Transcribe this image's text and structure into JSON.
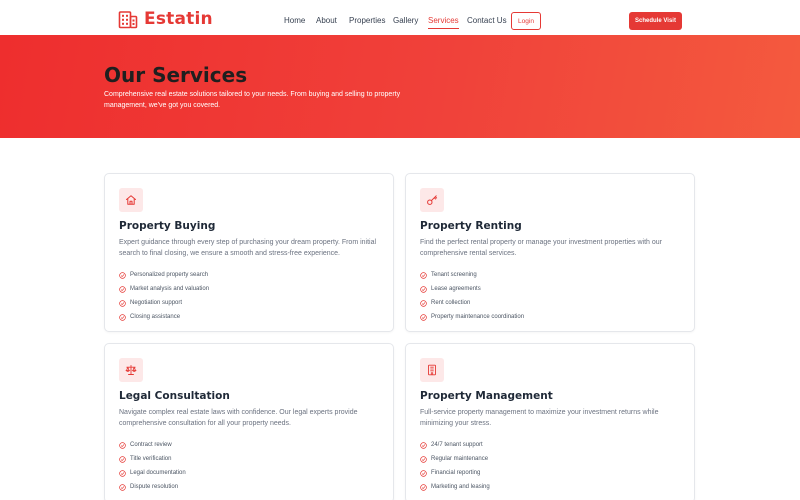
{
  "brand": {
    "name": "Estatin",
    "color": "#e53935"
  },
  "nav": {
    "items": [
      {
        "label": "Home",
        "active": false
      },
      {
        "label": "About",
        "active": false
      },
      {
        "label": "Properties",
        "active": false
      },
      {
        "label": "Gallery",
        "active": false
      },
      {
        "label": "Services",
        "active": true
      },
      {
        "label": "Contact Us",
        "active": false
      }
    ],
    "login_label": "Login",
    "cta_label": "Schedule Visit"
  },
  "hero": {
    "title": "Our Services",
    "subtitle": "Comprehensive real estate solutions tailored to your needs. From buying and selling to property management, we've got you covered."
  },
  "services": [
    {
      "icon": "home-icon",
      "title": "Property Buying",
      "description": "Expert guidance through every step of purchasing your dream property. From initial search to final closing, we ensure a smooth and stress-free experience.",
      "features": [
        "Personalized property search",
        "Market analysis and valuation",
        "Negotiation support",
        "Closing assistance"
      ]
    },
    {
      "icon": "key-icon",
      "title": "Property Renting",
      "description": "Find the perfect rental property or manage your investment properties with our comprehensive rental services.",
      "features": [
        "Tenant screening",
        "Lease agreements",
        "Rent collection",
        "Property maintenance coordination"
      ]
    },
    {
      "icon": "scale-icon",
      "title": "Legal Consultation",
      "description": "Navigate complex real estate laws with confidence. Our legal experts provide comprehensive consultation for all your property needs.",
      "features": [
        "Contract review",
        "Title verification",
        "Legal documentation",
        "Dispute resolution"
      ]
    },
    {
      "icon": "building-icon",
      "title": "Property Management",
      "description": "Full-service property management to maximize your investment returns while minimizing your stress.",
      "features": [
        "24/7 tenant support",
        "Regular maintenance",
        "Financial reporting",
        "Marketing and leasing"
      ]
    }
  ]
}
